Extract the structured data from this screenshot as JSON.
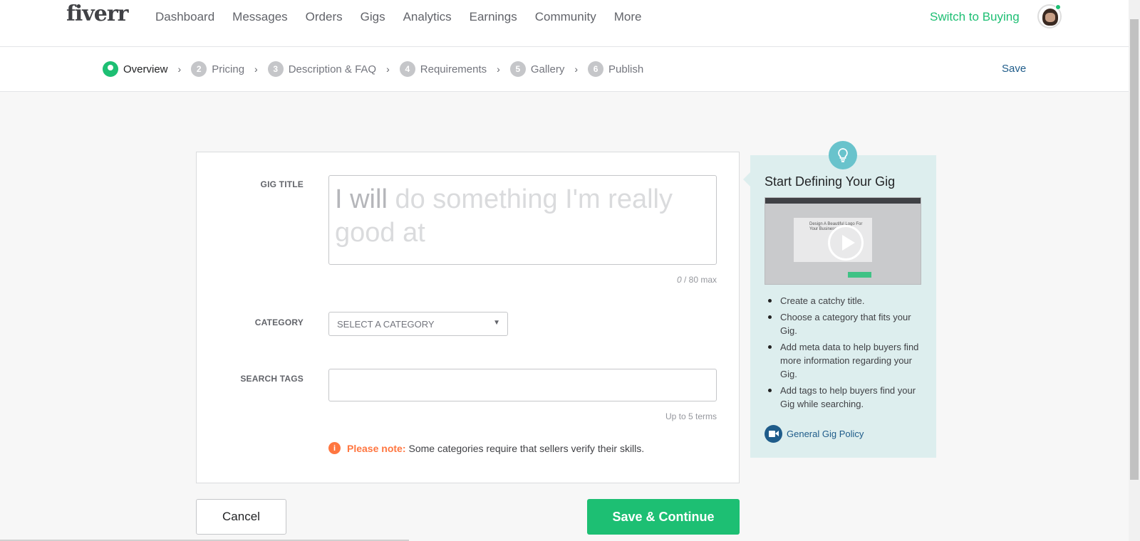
{
  "header": {
    "logo": "fiverr",
    "nav": [
      "Dashboard",
      "Messages",
      "Orders",
      "Gigs",
      "Analytics",
      "Earnings",
      "Community",
      "More"
    ],
    "switch_label": "Switch to Buying"
  },
  "steps": {
    "items": [
      {
        "num": "",
        "label": "Overview",
        "active": true
      },
      {
        "num": "2",
        "label": "Pricing"
      },
      {
        "num": "3",
        "label": "Description & FAQ"
      },
      {
        "num": "4",
        "label": "Requirements"
      },
      {
        "num": "5",
        "label": "Gallery"
      },
      {
        "num": "6",
        "label": "Publish"
      }
    ],
    "save_label": "Save"
  },
  "form": {
    "gig_title_label": "GIG TITLE",
    "gig_title_placeholder_strong": "I will",
    "gig_title_placeholder_rest": " do something I'm really good at",
    "char_count": "0",
    "char_max": " / 80 max",
    "category_label": "CATEGORY",
    "category_value": "SELECT A CATEGORY",
    "tags_label": "SEARCH TAGS",
    "tags_hint": "Up to 5 terms",
    "note_strong": "Please note:",
    "note_text": "Some categories require that sellers verify their skills."
  },
  "actions": {
    "cancel": "Cancel",
    "save_continue": "Save & Continue"
  },
  "sidebar": {
    "title": "Start Defining Your Gig",
    "video_caption": "Design A Beautiful Logo For Your Business",
    "tips": [
      "Create a catchy title.",
      "Choose a category that fits your Gig.",
      "Add meta data to help buyers find more information regarding your Gig.",
      "Add tags to help buyers find your Gig while searching."
    ],
    "policy_link": "General Gig Policy"
  }
}
